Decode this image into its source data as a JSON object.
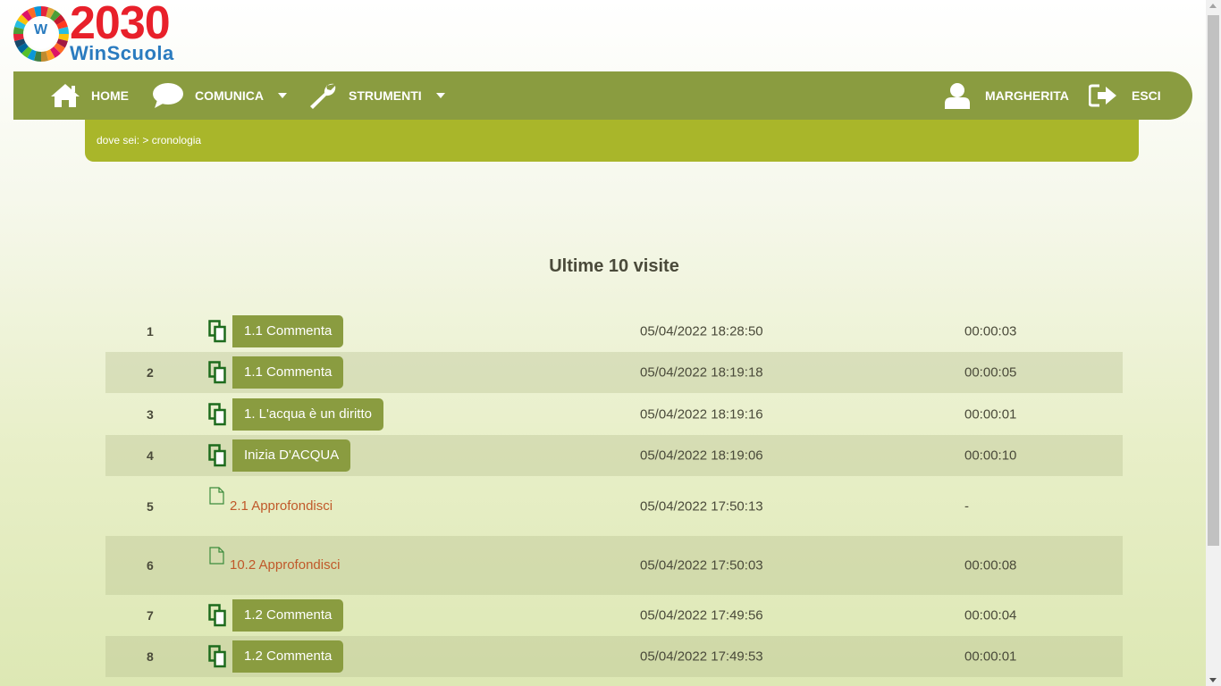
{
  "logo": {
    "number": "2030",
    "brand": "WinScuola",
    "wheel_letter": "W"
  },
  "nav": {
    "home": "HOME",
    "comunica": "COMUNICA",
    "strumenti": "STRUMENTI",
    "user": "MARGHERITA",
    "logout": "ESCI"
  },
  "breadcrumb": "dove sei: > cronologia",
  "title": "Ultime 10 visite",
  "colors": {
    "nav_green": "#8a9c40",
    "crumb_green": "#a9b62a",
    "link_orange": "#c0592a",
    "icon_dark_green": "#1d6b1d"
  },
  "rows": [
    {
      "num": "1",
      "kind": "activity",
      "label": "1.1 Commenta",
      "date": "05/04/2022 18:28:50",
      "duration": "00:00:03"
    },
    {
      "num": "2",
      "kind": "activity",
      "label": "1.1 Commenta",
      "date": "05/04/2022 18:19:18",
      "duration": "00:00:05"
    },
    {
      "num": "3",
      "kind": "activity",
      "label": "1. L'acqua è un diritto",
      "date": "05/04/2022 18:19:16",
      "duration": "00:00:01"
    },
    {
      "num": "4",
      "kind": "activity",
      "label": "Inizia D'ACQUA",
      "date": "05/04/2022 18:19:06",
      "duration": "00:00:10"
    },
    {
      "num": "5",
      "kind": "page",
      "label": "2.1 Approfondisci",
      "date": "05/04/2022 17:50:13",
      "duration": "-"
    },
    {
      "num": "6",
      "kind": "page",
      "label": "10.2 Approfondisci",
      "date": "05/04/2022 17:50:03",
      "duration": "00:00:08"
    },
    {
      "num": "7",
      "kind": "activity",
      "label": "1.2 Commenta",
      "date": "05/04/2022 17:49:56",
      "duration": "00:00:04"
    },
    {
      "num": "8",
      "kind": "activity",
      "label": "1.2 Commenta",
      "date": "05/04/2022 17:49:53",
      "duration": "00:00:01"
    }
  ]
}
